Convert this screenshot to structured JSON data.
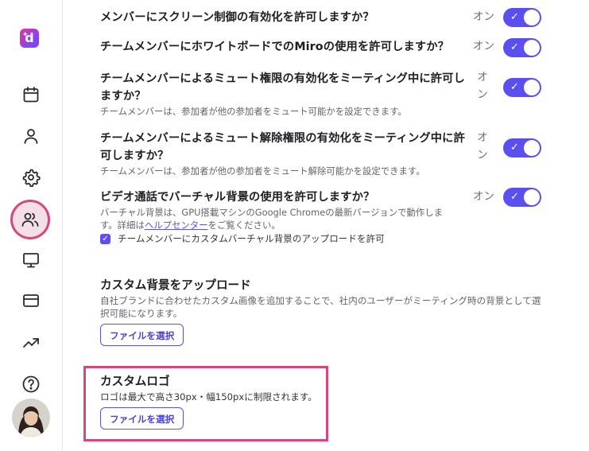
{
  "colors": {
    "accent": "#5b4ff0",
    "highlight": "#d4477f",
    "brand_gradient": [
      "#e0389a",
      "#6e49f0"
    ]
  },
  "sidebar": {
    "items": [
      {
        "icon": "calendar-icon"
      },
      {
        "icon": "user-icon"
      },
      {
        "icon": "gear-icon"
      },
      {
        "icon": "team-icon",
        "active": true
      },
      {
        "icon": "monitor-icon"
      },
      {
        "icon": "credit-card-icon"
      },
      {
        "icon": "trending-up-icon"
      },
      {
        "icon": "help-icon"
      }
    ]
  },
  "settings": {
    "on_label": "オン",
    "items": [
      {
        "question": "メンバーにスクリーン制御の有効化を許可しますか？",
        "enabled": true
      },
      {
        "question": "チームメンバーにホワイトボードでのMiroの使用を許可しますか？",
        "enabled": true
      },
      {
        "question": "チームメンバーによるミュート権限の有効化をミーティング中に許可しますか？",
        "description": "チームメンバーは、参加者が他の参加者をミュート可能かを設定できます。",
        "enabled": true
      },
      {
        "question": "チームメンバーによるミュート解除権限の有効化をミーティング中に許可しますか？",
        "description": "チームメンバーは、参加者が他の参加者をミュート解除可能かを設定できます。",
        "enabled": true
      },
      {
        "question": "ビデオ通話でバーチャル背景の使用を許可しますか？",
        "description_before": "バーチャル背景は、GPU搭載マシンのGoogle Chromeの最新バージョンで動作します。詳細は",
        "link": "ヘルプセンター",
        "description_after": "をご覧ください。",
        "enabled": true
      }
    ],
    "custom_bg_checkbox": {
      "label": "チームメンバーにカスタムバーチャル背景のアップロードを許可",
      "checked": true
    }
  },
  "upload_background": {
    "title": "カスタム背景をアップロード",
    "description": "自社ブランドに合わせたカスタム画像を追加することで、社内のユーザーがミーティング時の背景として選択可能になります。",
    "button": "ファイルを選択"
  },
  "custom_logo": {
    "title": "カスタムロゴ",
    "description": "ロゴは最大で高さ30px・幅150pxに制限されます。",
    "button": "ファイルを選択"
  }
}
